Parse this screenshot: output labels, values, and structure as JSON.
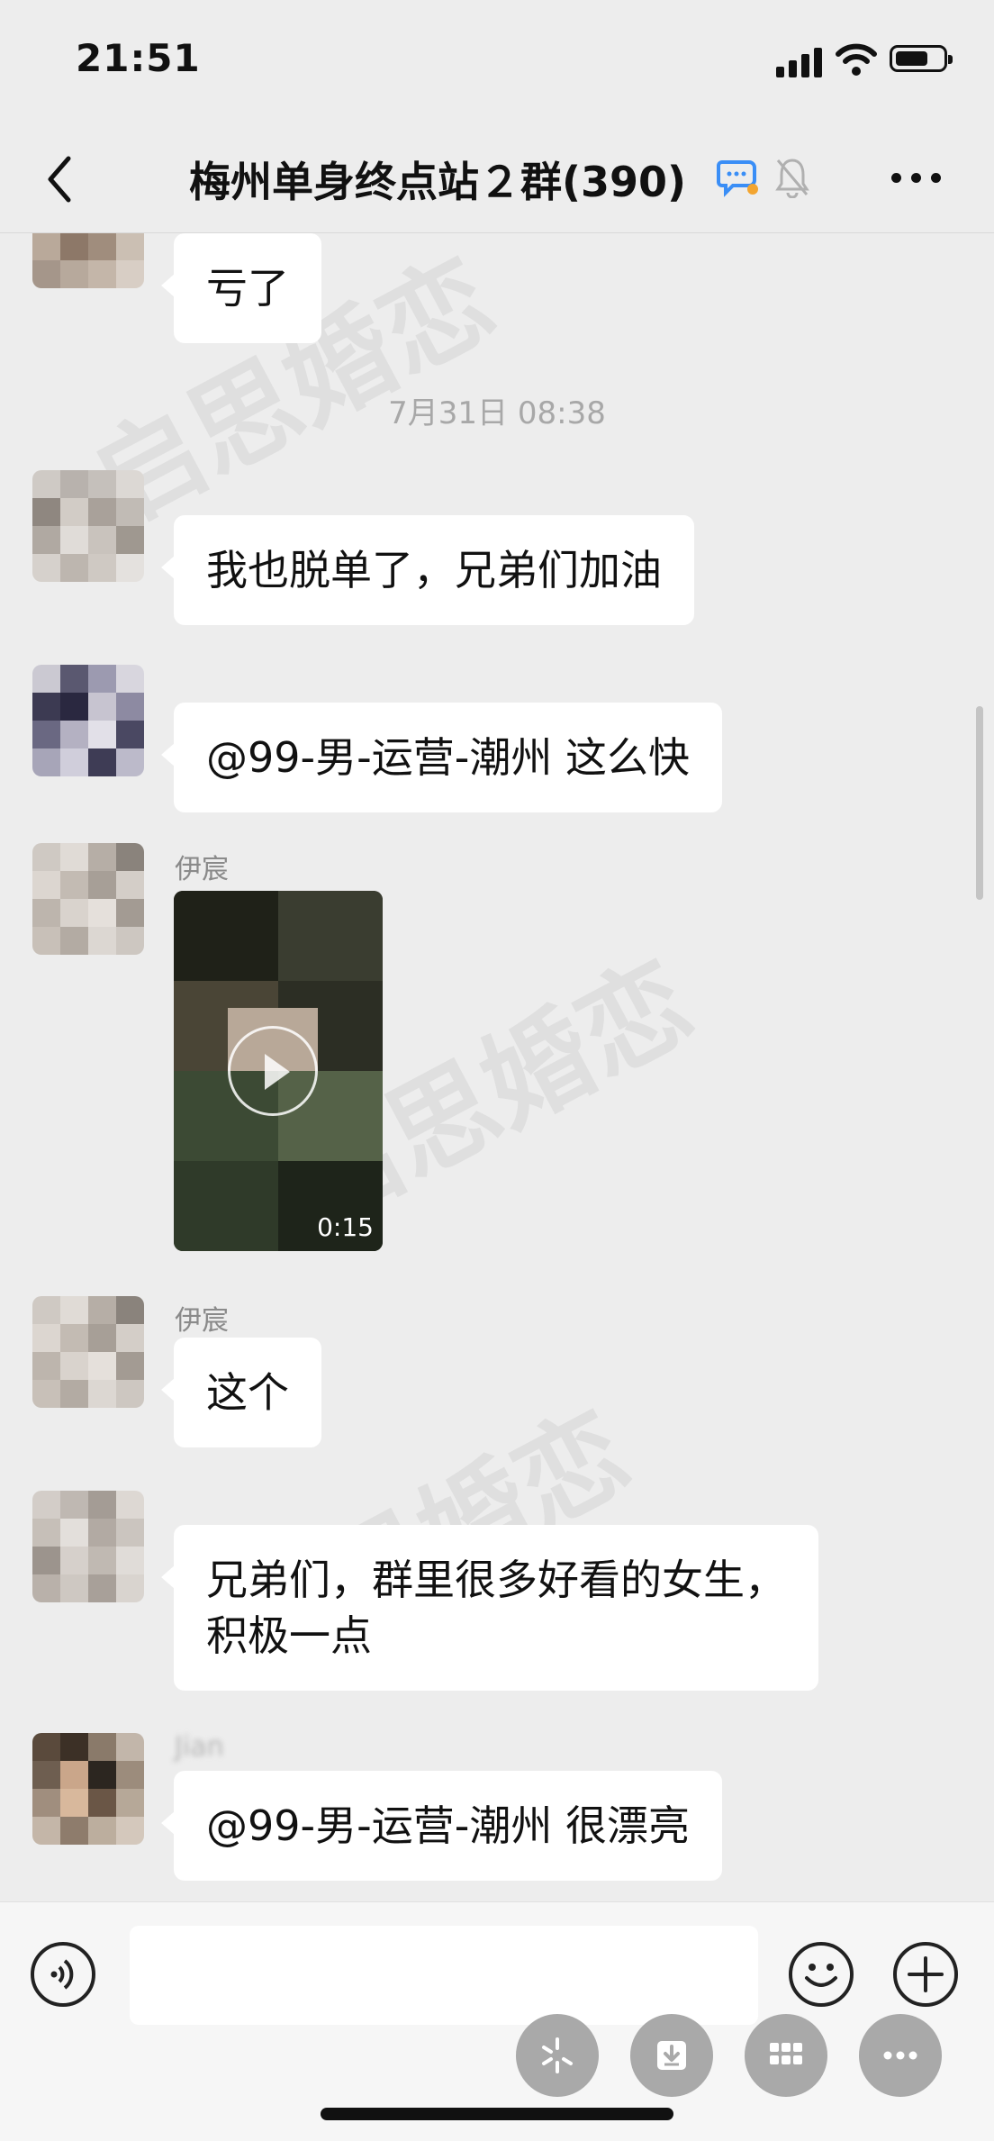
{
  "status_bar": {
    "time": "21:51",
    "battery_level": 0.7
  },
  "header": {
    "title": "梅州单身终点站２群(390)",
    "icons": [
      "back-arrow-icon",
      "group-chat-icon",
      "mute-bell-icon",
      "more-icon"
    ]
  },
  "watermark": "启思婚恋",
  "messages": [
    {
      "type": "text",
      "sender": "",
      "text": "亏了"
    },
    {
      "type": "timestamp",
      "text": "7月31日 08:38"
    },
    {
      "type": "text",
      "sender": "",
      "text": "我也脱单了，兄弟们加油"
    },
    {
      "type": "text",
      "sender": "",
      "text": "@99-男-运营-潮州 这么快"
    },
    {
      "type": "video",
      "sender": "伊宸",
      "duration": "0:15"
    },
    {
      "type": "text",
      "sender": "伊宸",
      "text": "这个"
    },
    {
      "type": "text",
      "sender": "",
      "text": "兄弟们，群里很多好看的女生，\n积极一点"
    },
    {
      "type": "text",
      "sender": "Jian",
      "text": "@99-男-运营-潮州 很漂亮"
    }
  ],
  "colors": {
    "background": "#ededed",
    "bubble": "#ffffff",
    "accent": "#3a8ef6"
  }
}
